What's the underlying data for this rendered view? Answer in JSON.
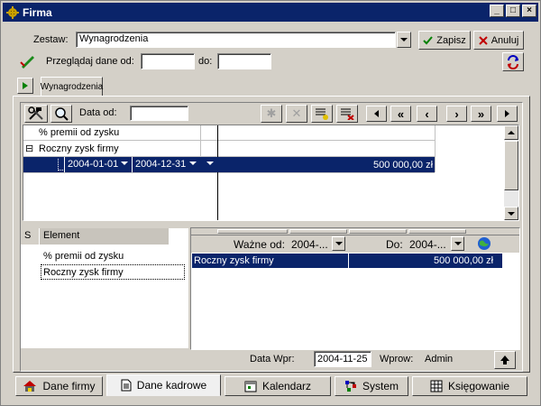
{
  "window": {
    "title": "Firma"
  },
  "form": {
    "zestaw_label": "Zestaw:",
    "zestaw_value": "Wynagrodzenia",
    "save_label": "Zapisz",
    "cancel_label": "Anuluj",
    "browse_label": "Przeglądaj dane od:",
    "to_label": "do:",
    "date_from": "",
    "date_to": ""
  },
  "tab": {
    "label": "Wynagrodzenia"
  },
  "toolbar": {
    "data_od_label": "Data od:",
    "data_od_value": ""
  },
  "tree": {
    "rows": [
      {
        "label": "% premii od zysku"
      },
      {
        "label": "Roczny zysk firmy",
        "expander": "⊟"
      }
    ],
    "selected": {
      "from": "2004-01-01",
      "to": "2004-12-31",
      "amount": "500 000,00 zł"
    }
  },
  "elements": {
    "col_s": "S",
    "col_element": "Element",
    "items": [
      "% premii od zysku",
      "Roczny zysk firmy"
    ]
  },
  "detail": {
    "valid_from_label": "Ważne od:",
    "valid_from_value": "2004-...",
    "valid_to_label": "Do:",
    "valid_to_value": "2004-...",
    "row_label": "Roczny zysk firmy",
    "row_amount": "500 000,00 zł"
  },
  "footer": {
    "data_wpr_label": "Data Wpr:",
    "data_wpr_value": "2004-11-25",
    "wprow_label": "Wprow:",
    "wprow_value": "Admin"
  },
  "bottom_tabs": [
    {
      "label": "Dane firmy",
      "icon": "house-icon"
    },
    {
      "label": "Dane kadrowe",
      "icon": "document-icon",
      "active": true
    },
    {
      "label": "Kalendarz",
      "icon": "calendar-icon"
    },
    {
      "label": "System",
      "icon": "system-icon"
    },
    {
      "label": "Księgowanie",
      "icon": "ledger-icon"
    }
  ],
  "colors": {
    "title_bar": "#0a246a",
    "selection": "#0a246a",
    "face": "#d4d0c8"
  }
}
